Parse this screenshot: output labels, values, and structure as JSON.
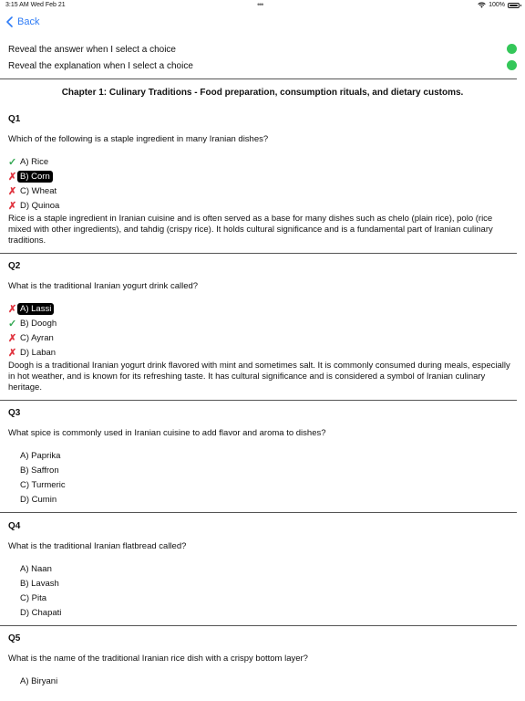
{
  "status_bar": {
    "time": "3:15 AM  Wed Feb 21",
    "battery": "100%"
  },
  "nav": {
    "back_label": "Back"
  },
  "settings": [
    {
      "label": "Reveal the answer when I select a choice",
      "on": true
    },
    {
      "label": "Reveal the explanation when I select a choice",
      "on": true
    }
  ],
  "chapter_title": "Chapter 1: Culinary Traditions - Food preparation, consumption rituals, and dietary customs.",
  "questions": [
    {
      "number": "Q1",
      "text": "Which of the following is a staple ingredient in many Iranian dishes?",
      "choices": [
        {
          "label": "A) Rice",
          "mark": "correct",
          "selected": false
        },
        {
          "label": "B) Corn",
          "mark": "wrong",
          "selected": true
        },
        {
          "label": "C) Wheat",
          "mark": "wrong",
          "selected": false
        },
        {
          "label": "D) Quinoa",
          "mark": "wrong",
          "selected": false
        }
      ],
      "explanation": "Rice is a staple ingredient in Iranian cuisine and is often served as a base for many dishes such as chelo (plain rice), polo (rice mixed with other ingredients), and tahdig (crispy rice). It holds cultural significance and is a fundamental part of Iranian culinary traditions."
    },
    {
      "number": "Q2",
      "text": "What is the traditional Iranian yogurt drink called?",
      "choices": [
        {
          "label": "A) Lassi",
          "mark": "wrong",
          "selected": true
        },
        {
          "label": "B) Doogh",
          "mark": "correct",
          "selected": false
        },
        {
          "label": "C) Ayran",
          "mark": "wrong",
          "selected": false
        },
        {
          "label": "D) Laban",
          "mark": "wrong",
          "selected": false
        }
      ],
      "explanation": "Doogh is a traditional Iranian yogurt drink flavored with mint and sometimes salt. It is commonly consumed during meals, especially in hot weather, and is known for its refreshing taste. It has cultural significance and is considered a symbol of Iranian culinary heritage."
    },
    {
      "number": "Q3",
      "text": "What spice is commonly used in Iranian cuisine to add flavor and aroma to dishes?",
      "choices": [
        {
          "label": "A) Paprika",
          "mark": "",
          "selected": false
        },
        {
          "label": "B) Saffron",
          "mark": "",
          "selected": false
        },
        {
          "label": "C) Turmeric",
          "mark": "",
          "selected": false
        },
        {
          "label": "D) Cumin",
          "mark": "",
          "selected": false
        }
      ],
      "explanation": ""
    },
    {
      "number": "Q4",
      "text": "What is the traditional Iranian flatbread called?",
      "choices": [
        {
          "label": "A) Naan",
          "mark": "",
          "selected": false
        },
        {
          "label": "B) Lavash",
          "mark": "",
          "selected": false
        },
        {
          "label": "C) Pita",
          "mark": "",
          "selected": false
        },
        {
          "label": "D) Chapati",
          "mark": "",
          "selected": false
        }
      ],
      "explanation": ""
    },
    {
      "number": "Q5",
      "text": "What is the name of the traditional Iranian rice dish with a crispy bottom layer?",
      "choices": [
        {
          "label": "A) Biryani",
          "mark": "",
          "selected": false
        }
      ],
      "explanation": ""
    }
  ]
}
